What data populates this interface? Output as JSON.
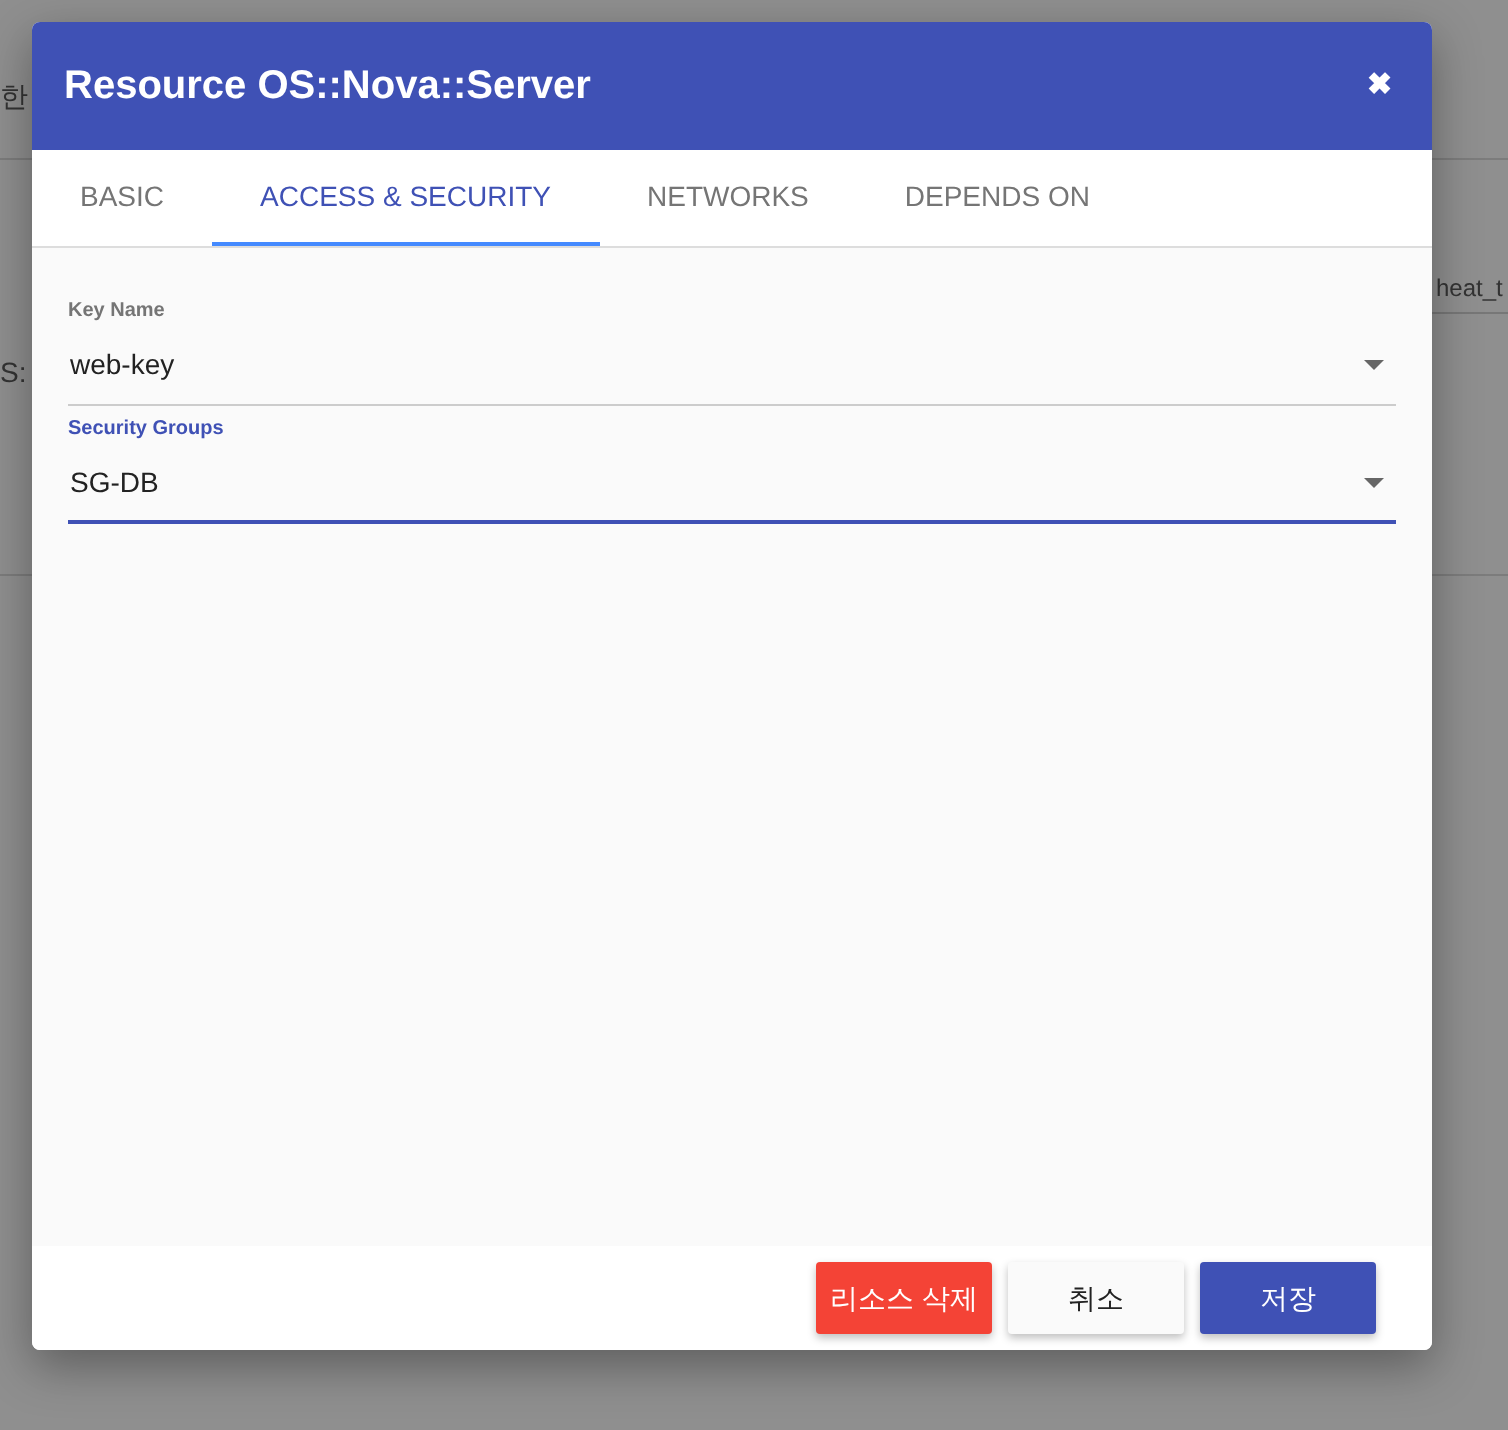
{
  "background": {
    "left_label": "한",
    "left_field_label": "S:",
    "right_field_value": "heat_t"
  },
  "dialog": {
    "title": "Resource OS::Nova::Server",
    "close": "✖",
    "tabs": [
      {
        "label": "BASIC",
        "selected": false
      },
      {
        "label": "ACCESS & SECURITY",
        "selected": true
      },
      {
        "label": "NETWORKS",
        "selected": false
      },
      {
        "label": "DEPENDS ON",
        "selected": false
      }
    ],
    "fields": [
      {
        "label": "Key Name",
        "value": "web-key",
        "focused": false
      },
      {
        "label": "Security Groups",
        "value": "SG-DB",
        "focused": true
      }
    ],
    "buttons": [
      {
        "label": "리소스 삭제",
        "kind": "danger"
      },
      {
        "label": "취소",
        "kind": "plain"
      },
      {
        "label": "저장",
        "kind": "primary"
      }
    ]
  }
}
